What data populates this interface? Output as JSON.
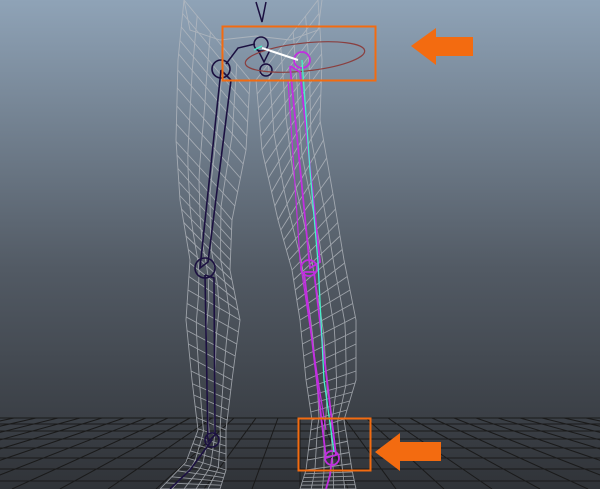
{
  "viewport": {
    "background_top": "#8fa3b7",
    "background_bottom": "#303338"
  },
  "colors": {
    "mesh_wireframe": "#b8bcc2",
    "left_leg_joint_chain": "#1b1040",
    "right_leg_joint_chain": "#c22ee0",
    "selection_highlight": "#47f0c8",
    "selected_bone": "#ffffff",
    "callout_orange": "#f36b10",
    "ground_grid": "#1a1a1a"
  },
  "annotations": [
    {
      "shape": "rectangle",
      "marks": "hip-joint-area"
    },
    {
      "shape": "arrow",
      "points": "left",
      "marks": "hip-joint-area"
    },
    {
      "shape": "rectangle",
      "marks": "ankle-joint-area"
    },
    {
      "shape": "arrow",
      "points": "left",
      "marks": "ankle-joint-area"
    }
  ]
}
